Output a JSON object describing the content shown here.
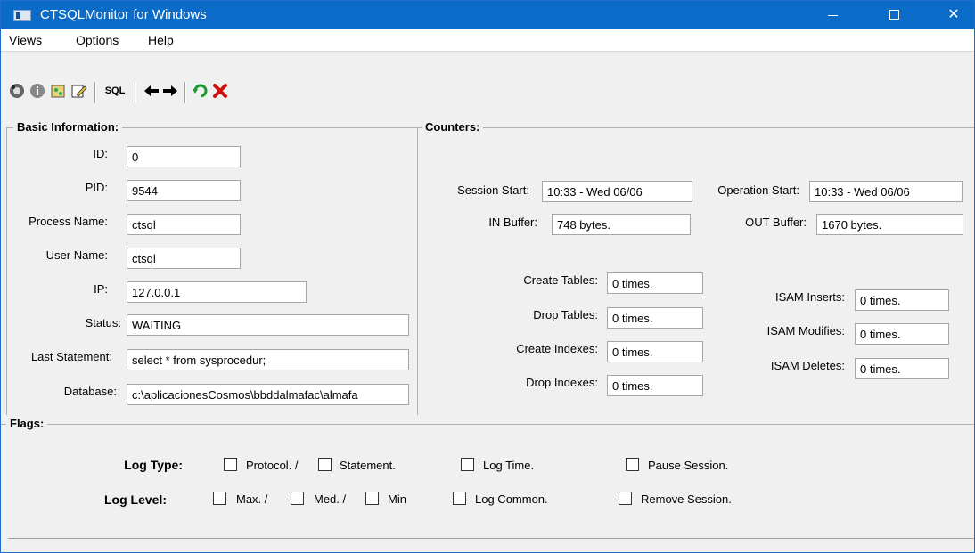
{
  "window": {
    "title": "CTSQLMonitor for Windows",
    "minimize": "—",
    "maximize": "",
    "close": "✕"
  },
  "menu": {
    "views": "Views",
    "options": "Options",
    "help": "Help"
  },
  "toolbar": {
    "sql_label": "SQL",
    "icons": [
      "connect-icon",
      "info-icon",
      "sessions-icon",
      "edit-icon",
      "sql-icon",
      "back-arrow-icon",
      "forward-arrow-icon",
      "refresh-icon",
      "delete-icon"
    ]
  },
  "basic": {
    "title": "Basic Information:",
    "id_label": "ID:",
    "id": "0",
    "pid_label": "PID:",
    "pid": "9544",
    "process_label": "Process Name:",
    "process": "ctsql",
    "user_label": "User Name:",
    "user": "ctsql",
    "ip_label": "IP:",
    "ip": "127.0.0.1",
    "status_label": "Status:",
    "status": "WAITING",
    "last_label": "Last Statement:",
    "last": "select * from sysprocedur;",
    "db_label": "Database:",
    "db": "c:\\aplicacionesCosmos\\bbddalmafac\\almafa"
  },
  "counters": {
    "title": "Counters:",
    "session_start_label": "Session Start:",
    "session_start": "10:33 - Wed 06/06",
    "operation_start_label": "Operation Start:",
    "operation_start": "10:33 - Wed 06/06",
    "in_buffer_label": "IN Buffer:",
    "in_buffer": "748 bytes.",
    "out_buffer_label": "OUT Buffer:",
    "out_buffer": "1670 bytes.",
    "create_tables_label": "Create Tables:",
    "create_tables": "0 times.",
    "drop_tables_label": "Drop Tables:",
    "drop_tables": "0 times.",
    "create_indexes_label": "Create Indexes:",
    "create_indexes": "0 times.",
    "drop_indexes_label": "Drop Indexes:",
    "drop_indexes": "0 times.",
    "isam_inserts_label": "ISAM Inserts:",
    "isam_inserts": "0 times.",
    "isam_modifies_label": "ISAM Modifies:",
    "isam_modifies": "0 times.",
    "isam_deletes_label": "ISAM Deletes:",
    "isam_deletes": "0 times."
  },
  "flags": {
    "title": "Flags:",
    "log_type_label": "Log Type:",
    "protocol": "Protocol. /",
    "statement": "Statement.",
    "log_time": "Log Time.",
    "pause_session": "Pause Session.",
    "log_level_label": "Log Level:",
    "max": "Max. /",
    "med": "Med. /",
    "min": "Min",
    "log_common": "Log Common.",
    "remove_session": "Remove Session."
  }
}
